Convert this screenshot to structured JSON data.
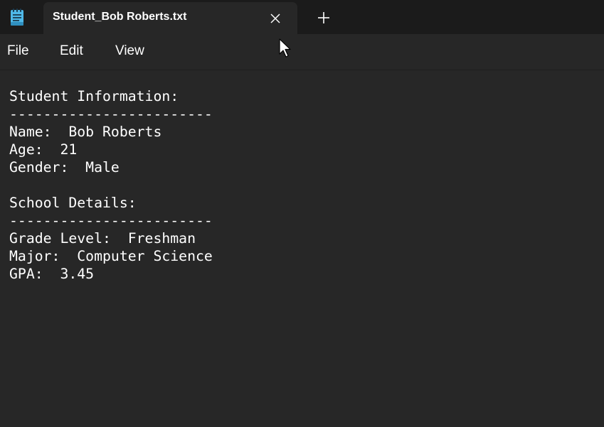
{
  "window": {
    "app_icon": "notepad-icon",
    "tab": {
      "title": "Student_Bob Roberts.txt",
      "close_icon": "close-icon"
    },
    "new_tab_icon": "plus-icon"
  },
  "menu": {
    "items": [
      {
        "label": "File"
      },
      {
        "label": "Edit"
      },
      {
        "label": "View"
      }
    ]
  },
  "document": {
    "lines": [
      "Student Information:",
      "------------------------",
      "Name:  Bob Roberts",
      "Age:  21",
      "Gender:  Male",
      "",
      "School Details:",
      "------------------------",
      "Grade Level:  Freshman",
      "Major:  Computer Science",
      "GPA:  3.45"
    ]
  },
  "colors": {
    "titlebar_bg": "#1b1b1b",
    "editor_bg": "#272727",
    "text": "#ffffff",
    "icon_blue": "#4fb8e8"
  }
}
